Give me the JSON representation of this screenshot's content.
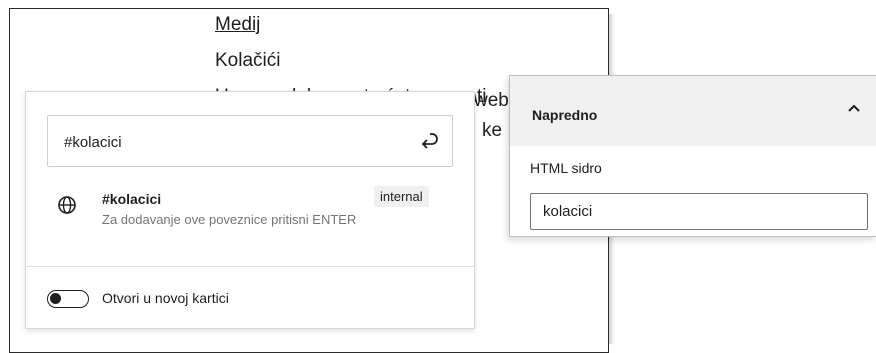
{
  "editor": {
    "link_text": "Medij",
    "heading": "Kolačići",
    "paragraph_line1": "U ovom dokumentu ćete saznati",
    "paragraph_line2": "",
    "fragment_web": "web",
    "fragment_ke": "ke"
  },
  "link_popover": {
    "search_value": "#kolacici",
    "submit_icon": "enter-return-icon",
    "suggestion": {
      "icon": "globe-icon",
      "title": "#kolacici",
      "description": "Za dodavanje ove poveznice pritisni ENTER",
      "badge": "internal"
    },
    "toggle": {
      "label": "Otvori u novoj kartici",
      "checked": false
    }
  },
  "advanced_panel": {
    "title": "Napredno",
    "expanded": true,
    "chevron_icon": "chevron-up-icon",
    "anchor_label": "HTML sidro",
    "anchor_value": "kolacici"
  }
}
